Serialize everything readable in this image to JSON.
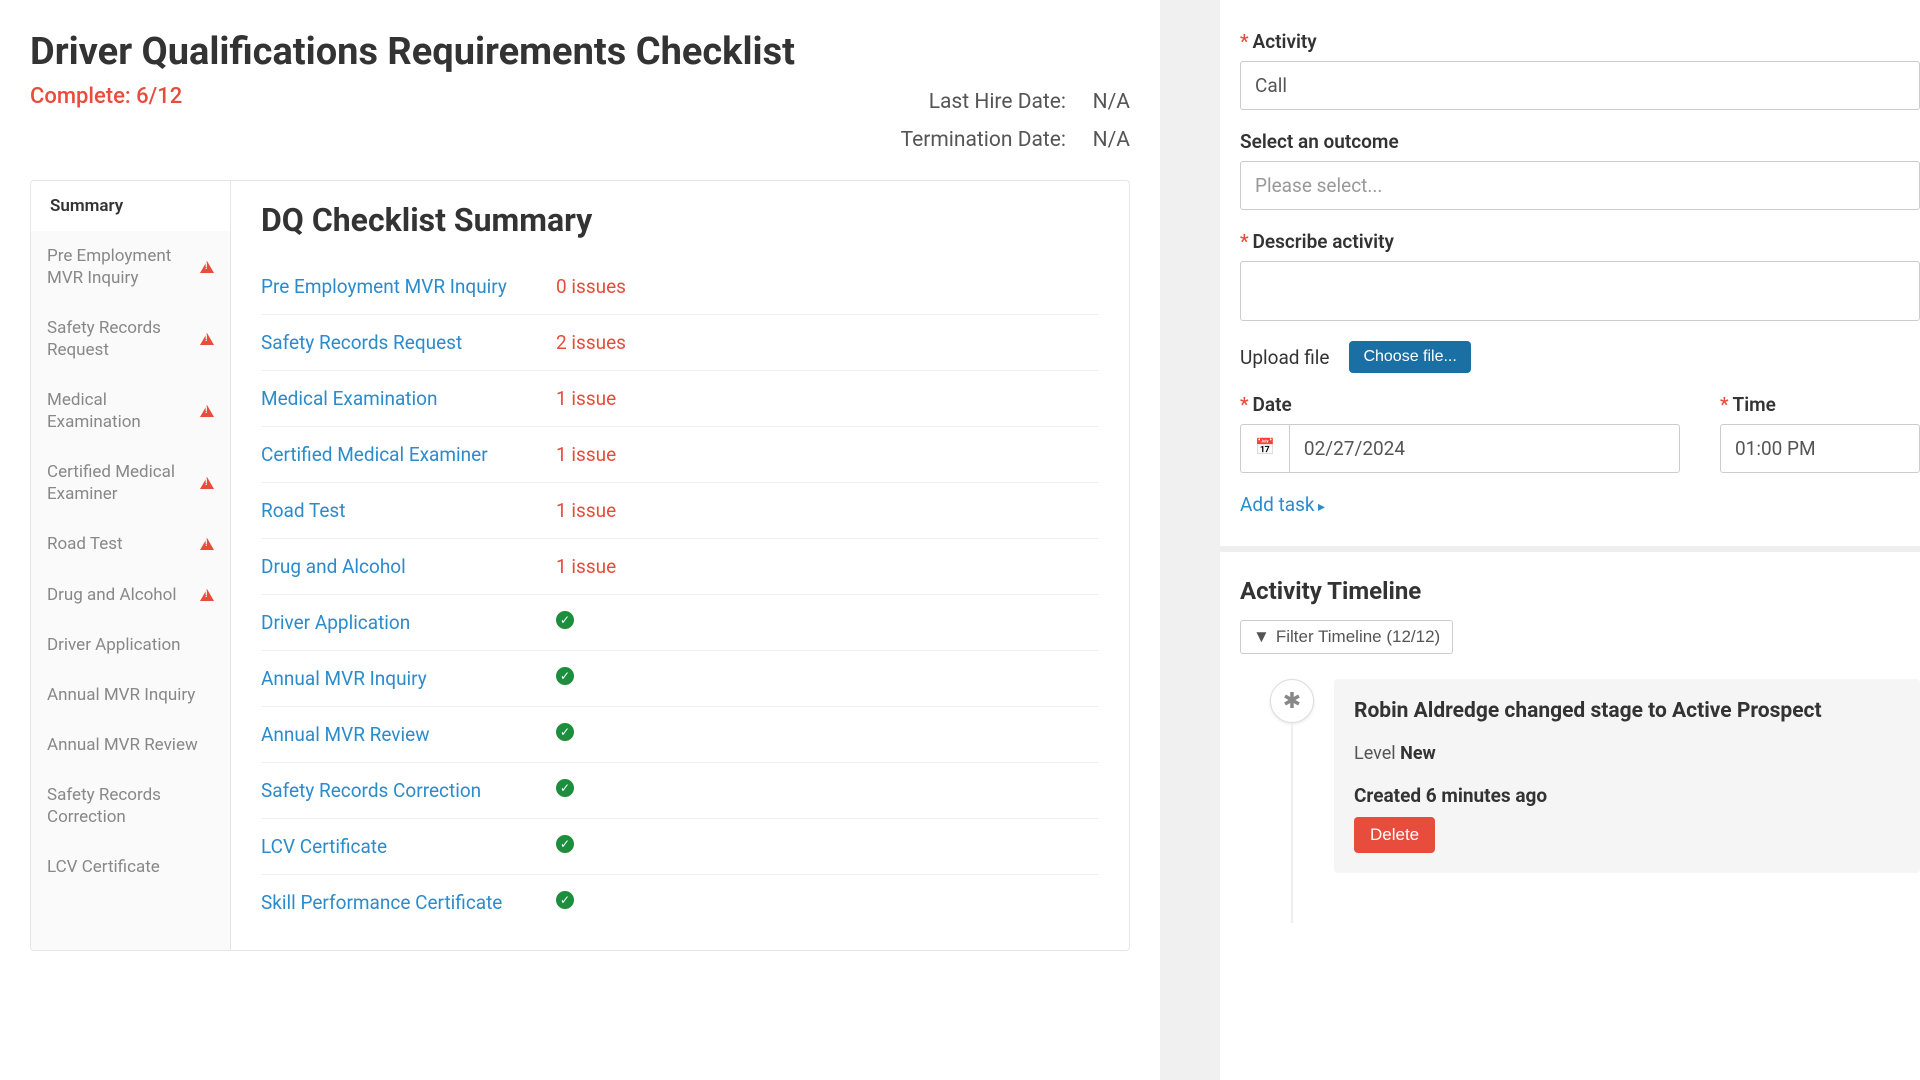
{
  "page_title": "Driver Qualifications Requirements Checklist",
  "complete_status": "Complete: 6/12",
  "last_hire_label": "Last Hire Date:",
  "last_hire_value": "N/A",
  "termination_label": "Termination Date:",
  "termination_value": "N/A",
  "sidebar": {
    "items": [
      {
        "label": "Summary",
        "warn": false,
        "active": true
      },
      {
        "label": "Pre Employment MVR Inquiry",
        "warn": true
      },
      {
        "label": "Safety Records Request",
        "warn": true
      },
      {
        "label": "Medical Examination",
        "warn": true
      },
      {
        "label": "Certified Medical Examiner",
        "warn": true
      },
      {
        "label": "Road Test",
        "warn": true
      },
      {
        "label": "Drug and Alcohol",
        "warn": true
      },
      {
        "label": "Driver Application",
        "warn": false
      },
      {
        "label": "Annual MVR Inquiry",
        "warn": false
      },
      {
        "label": "Annual MVR Review",
        "warn": false
      },
      {
        "label": "Safety Records Correction",
        "warn": false
      },
      {
        "label": "LCV Certificate",
        "warn": false
      }
    ]
  },
  "summary_title": "DQ Checklist Summary",
  "checklist": [
    {
      "name": "Pre Employment MVR Inquiry",
      "status": "0 issues",
      "type": "issue"
    },
    {
      "name": "Safety Records Request",
      "status": "2 issues",
      "type": "issue"
    },
    {
      "name": "Medical Examination",
      "status": "1 issue",
      "type": "issue"
    },
    {
      "name": "Certified Medical Examiner",
      "status": "1 issue",
      "type": "issue"
    },
    {
      "name": "Road Test",
      "status": "1 issue",
      "type": "issue"
    },
    {
      "name": "Drug and Alcohol",
      "status": "1 issue",
      "type": "issue"
    },
    {
      "name": "Driver Application",
      "status": "",
      "type": "check"
    },
    {
      "name": "Annual MVR Inquiry",
      "status": "",
      "type": "check"
    },
    {
      "name": "Annual MVR Review",
      "status": "",
      "type": "check"
    },
    {
      "name": "Safety Records Correction",
      "status": "",
      "type": "check"
    },
    {
      "name": "LCV Certificate",
      "status": "",
      "type": "check"
    },
    {
      "name": "Skill Performance Certificate",
      "status": "",
      "type": "check"
    }
  ],
  "form": {
    "activity_label": "Activity",
    "activity_value": "Call",
    "outcome_label": "Select an outcome",
    "outcome_placeholder": "Please select...",
    "describe_label": "Describe activity",
    "upload_label": "Upload file",
    "choose_file_label": "Choose file...",
    "date_label": "Date",
    "date_value": "02/27/2024",
    "time_label": "Time",
    "time_value": "01:00 PM",
    "add_task_label": "Add task"
  },
  "timeline": {
    "title": "Activity Timeline",
    "filter_label": "Filter Timeline (12/12)",
    "event": {
      "title": "Robin Aldredge changed stage to Active Prospect",
      "level_label": "Level ",
      "level_value": "New",
      "created": "Created 6 minutes ago",
      "delete_label": "Delete"
    }
  }
}
